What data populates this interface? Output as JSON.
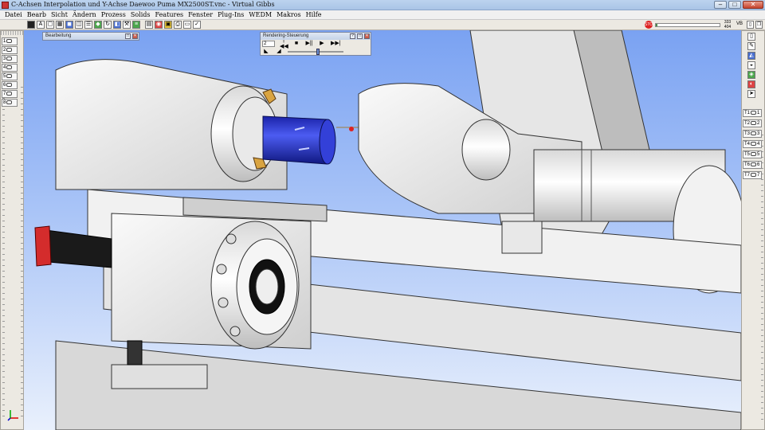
{
  "window": {
    "title": "C-Achsen Interpolation und Y-Achse Daewoo Puma MX2500ST.vnc - Virtual Gibbs",
    "min_label": "–",
    "max_label": "□",
    "close_label": "✕"
  },
  "menu": [
    "Datei",
    "Bearb",
    "Sicht",
    "Ändern",
    "Prozess",
    "Solids",
    "Features",
    "Fenster",
    "Plug-Ins",
    "WEDM",
    "Makros",
    "Hilfe"
  ],
  "toolbar": {
    "stop_label": "STOP",
    "counter_top": "333",
    "counter_bottom": "404",
    "vb_label": "VB",
    "progress": 0.02
  },
  "left_panel": {
    "slots": [
      {
        "n": "1"
      },
      {
        "n": "2"
      },
      {
        "n": "3"
      },
      {
        "n": "4"
      },
      {
        "n": "5"
      },
      {
        "n": "6"
      },
      {
        "n": "7"
      },
      {
        "n": "8"
      }
    ]
  },
  "right_panel": {
    "slots": [
      {
        "label": "T1",
        "n": "1"
      },
      {
        "label": "T2",
        "n": "2"
      },
      {
        "label": "T3",
        "n": "3"
      },
      {
        "label": "T4",
        "n": "4"
      },
      {
        "label": "T5",
        "n": "5"
      },
      {
        "label": "T6",
        "n": "6"
      },
      {
        "label": "T7",
        "n": "7"
      }
    ]
  },
  "bearbeitung_window": {
    "title": "Bearbeitung"
  },
  "sim_control": {
    "title": "Rendering-Steuerung",
    "field_value": "2",
    "controls": [
      "|◀◀",
      "■",
      "▶||",
      "▶",
      "▶▶|"
    ],
    "speed": 0.55
  },
  "colors": {
    "viewport_sky": "#7aa2f2",
    "tool_blue": "#2233cc",
    "stop_red": "#dd2222"
  }
}
